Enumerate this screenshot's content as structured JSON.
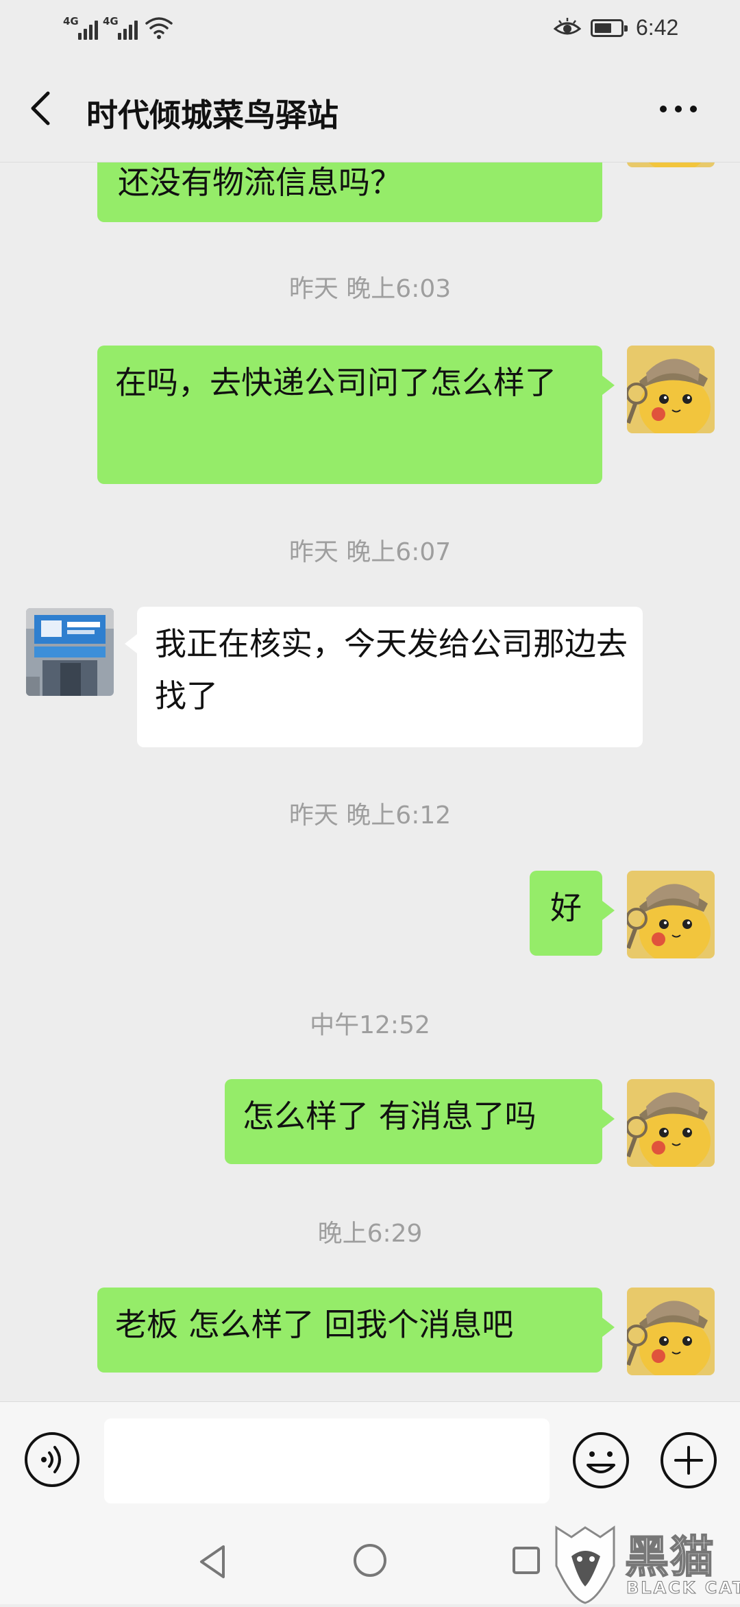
{
  "status_bar": {
    "signal1_label": "4G",
    "signal2_label": "4G",
    "clock": "6:42",
    "icons": [
      "signal-icon",
      "wifi-icon",
      "eye-comfort-icon",
      "battery-icon"
    ]
  },
  "header": {
    "title": "时代倾城菜鸟驿站",
    "icons": [
      "back-arrow-icon",
      "more-dots-icon"
    ]
  },
  "messages": [
    {
      "type": "out",
      "text": "还没有物流信息吗？"
    },
    {
      "type": "time",
      "text": "昨天 晚上6:03"
    },
    {
      "type": "out",
      "text": "在吗，去快递公司问了怎么样了"
    },
    {
      "type": "time",
      "text": "昨天 晚上6:07"
    },
    {
      "type": "in",
      "text": "我正在核实，今天发给公司那边去找了"
    },
    {
      "type": "time",
      "text": "昨天 晚上6:12"
    },
    {
      "type": "out",
      "text": "好"
    },
    {
      "type": "time",
      "text": "中午12:52"
    },
    {
      "type": "out",
      "text": "怎么样了 有消息了吗"
    },
    {
      "type": "time",
      "text": "晚上6:29"
    },
    {
      "type": "out",
      "text": "老板 怎么样了 回我个消息吧"
    }
  ],
  "input_bar": {
    "value": "",
    "icons": [
      "voice-icon",
      "emoji-icon",
      "plus-icon"
    ]
  },
  "nav_bar": {
    "icons": [
      "nav-back-icon",
      "nav-home-icon",
      "nav-recent-icon"
    ]
  },
  "watermark": {
    "text_cn": "黑猫",
    "text_en": "BLACK CAT"
  },
  "colors": {
    "outgoing_bubble": "#95ec69",
    "incoming_bubble": "#ffffff",
    "background": "#ededed",
    "timestamp": "#9e9e9e"
  }
}
